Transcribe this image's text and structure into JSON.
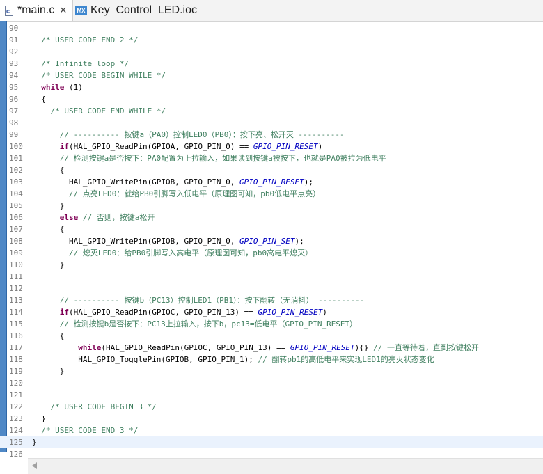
{
  "tabs": [
    {
      "label": "*main.c",
      "icon": "c-file-icon",
      "icon_text": "c",
      "active": true
    },
    {
      "label": "Key_Control_LED.ioc",
      "icon": "mx-icon",
      "icon_text": "MX",
      "active": false
    }
  ],
  "close_glyph": "✕",
  "colors": {
    "comment": "#3f7f5f",
    "keyword": "#7f0055",
    "macro": "#0000c0",
    "gutter": "#4f88c6",
    "current_line": "#eaf2fd"
  },
  "editor": {
    "current_line": 125,
    "lines": [
      {
        "n": "90",
        "segs": []
      },
      {
        "n": "91",
        "segs": [
          {
            "t": "  "
          },
          {
            "t": "/* USER CODE END 2 */",
            "c": "c"
          }
        ]
      },
      {
        "n": "92",
        "segs": []
      },
      {
        "n": "93",
        "segs": [
          {
            "t": "  "
          },
          {
            "t": "/* Infinite loop */",
            "c": "c"
          }
        ]
      },
      {
        "n": "94",
        "segs": [
          {
            "t": "  "
          },
          {
            "t": "/* USER CODE BEGIN WHILE */",
            "c": "c"
          }
        ]
      },
      {
        "n": "95",
        "segs": [
          {
            "t": "  "
          },
          {
            "t": "while",
            "c": "k"
          },
          {
            "t": " (1)"
          }
        ]
      },
      {
        "n": "96",
        "segs": [
          {
            "t": "  {"
          }
        ]
      },
      {
        "n": "97",
        "segs": [
          {
            "t": "    "
          },
          {
            "t": "/* USER CODE END WHILE */",
            "c": "c"
          }
        ]
      },
      {
        "n": "98",
        "segs": []
      },
      {
        "n": "99",
        "segs": [
          {
            "t": "      "
          },
          {
            "t": "// ---------- 按键a（PA0）控制LED0（PB0）：按下亮、松开灭 ----------",
            "c": "c"
          }
        ]
      },
      {
        "n": "100",
        "segs": [
          {
            "t": "      "
          },
          {
            "t": "if",
            "c": "k"
          },
          {
            "t": "(HAL_GPIO_ReadPin(GPIOA, GPIO_PIN_0) == "
          },
          {
            "t": "GPIO_PIN_RESET",
            "c": "m"
          },
          {
            "t": ")"
          }
        ]
      },
      {
        "n": "101",
        "segs": [
          {
            "t": "      "
          },
          {
            "t": "// 检测按键a是否按下：PA0配置为上拉输入，如果读到按键a被按下，也就是PA0被拉为低电平",
            "c": "c"
          }
        ]
      },
      {
        "n": "102",
        "segs": [
          {
            "t": "      {"
          }
        ]
      },
      {
        "n": "103",
        "segs": [
          {
            "t": "        HAL_GPIO_WritePin(GPIOB, GPIO_PIN_0, "
          },
          {
            "t": "GPIO_PIN_RESET",
            "c": "m"
          },
          {
            "t": ");"
          }
        ]
      },
      {
        "n": "104",
        "segs": [
          {
            "t": "        "
          },
          {
            "t": "// 点亮LED0：就给PB0引脚写入低电平（原理图可知，pb0低电平点亮）",
            "c": "c"
          }
        ]
      },
      {
        "n": "105",
        "segs": [
          {
            "t": "      }"
          }
        ]
      },
      {
        "n": "106",
        "segs": [
          {
            "t": "      "
          },
          {
            "t": "else",
            "c": "k"
          },
          {
            "t": " "
          },
          {
            "t": "// 否则，按键a松开",
            "c": "c"
          }
        ]
      },
      {
        "n": "107",
        "segs": [
          {
            "t": "      {"
          }
        ]
      },
      {
        "n": "108",
        "segs": [
          {
            "t": "        HAL_GPIO_WritePin(GPIOB, GPIO_PIN_0, "
          },
          {
            "t": "GPIO_PIN_SET",
            "c": "m"
          },
          {
            "t": ");"
          }
        ]
      },
      {
        "n": "109",
        "segs": [
          {
            "t": "        "
          },
          {
            "t": "// 熄灭LED0：给PB0引脚写入高电平（原理图可知，pb0高电平熄灭）",
            "c": "c"
          }
        ]
      },
      {
        "n": "110",
        "segs": [
          {
            "t": "      }"
          }
        ]
      },
      {
        "n": "111",
        "segs": []
      },
      {
        "n": "112",
        "segs": []
      },
      {
        "n": "113",
        "segs": [
          {
            "t": "      "
          },
          {
            "t": "// ---------- 按键b（PC13）控制LED1（PB1）：按下翻转（无消抖） ----------",
            "c": "c"
          }
        ]
      },
      {
        "n": "114",
        "segs": [
          {
            "t": "      "
          },
          {
            "t": "if",
            "c": "k"
          },
          {
            "t": "(HAL_GPIO_ReadPin(GPIOC, GPIO_PIN_13) == "
          },
          {
            "t": "GPIO_PIN_RESET",
            "c": "m"
          },
          {
            "t": ")"
          }
        ]
      },
      {
        "n": "115",
        "segs": [
          {
            "t": "      "
          },
          {
            "t": "// 检测按键b是否按下：PC13上拉输入，按下b，pc13=低电平（GPIO_PIN_RESET）",
            "c": "c"
          }
        ]
      },
      {
        "n": "116",
        "segs": [
          {
            "t": "      {"
          }
        ]
      },
      {
        "n": "117",
        "segs": [
          {
            "t": "          "
          },
          {
            "t": "while",
            "c": "k"
          },
          {
            "t": "(HAL_GPIO_ReadPin(GPIOC, GPIO_PIN_13) == "
          },
          {
            "t": "GPIO_PIN_RESET",
            "c": "m"
          },
          {
            "t": "){} "
          },
          {
            "t": "// 一直等待着，直到按键松开",
            "c": "c"
          }
        ]
      },
      {
        "n": "118",
        "segs": [
          {
            "t": "          HAL_GPIO_TogglePin(GPIOB, GPIO_PIN_1); "
          },
          {
            "t": "// 翻转pb1的高低电平来实现LED1的亮灭状态变化",
            "c": "c"
          }
        ]
      },
      {
        "n": "119",
        "segs": [
          {
            "t": "      }"
          }
        ]
      },
      {
        "n": "120",
        "segs": []
      },
      {
        "n": "121",
        "segs": []
      },
      {
        "n": "122",
        "segs": [
          {
            "t": "    "
          },
          {
            "t": "/* USER CODE BEGIN 3 */",
            "c": "c"
          }
        ]
      },
      {
        "n": "123",
        "segs": [
          {
            "t": "  }"
          }
        ]
      },
      {
        "n": "124",
        "segs": [
          {
            "t": "  "
          },
          {
            "t": "/* USER CODE END 3 */",
            "c": "c"
          }
        ]
      },
      {
        "n": "125",
        "segs": [
          {
            "t": "}"
          }
        ]
      },
      {
        "n": "126",
        "segs": []
      }
    ]
  },
  "hscroll": {
    "icon": "scroll-left-arrow-icon"
  }
}
